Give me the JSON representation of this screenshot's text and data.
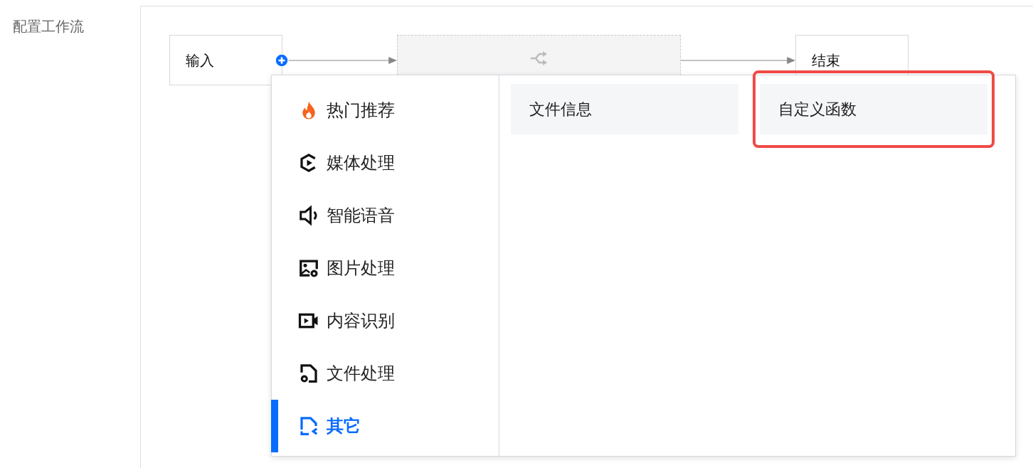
{
  "field_label": "配置工作流",
  "flow": {
    "start_node": "输入",
    "end_node": "结束"
  },
  "menu": {
    "categories": [
      {
        "label": "热门推荐",
        "kind": "flame",
        "selected": false
      },
      {
        "label": "媒体处理",
        "kind": "media",
        "selected": false
      },
      {
        "label": "智能语音",
        "kind": "speaker",
        "selected": false
      },
      {
        "label": "图片处理",
        "kind": "image",
        "selected": false
      },
      {
        "label": "内容识别",
        "kind": "video",
        "selected": false
      },
      {
        "label": "文件处理",
        "kind": "file",
        "selected": false
      },
      {
        "label": "其它",
        "kind": "other",
        "selected": true
      }
    ],
    "options": [
      {
        "label": "文件信息",
        "highlighted": false
      },
      {
        "label": "自定义函数",
        "highlighted": true
      }
    ]
  }
}
